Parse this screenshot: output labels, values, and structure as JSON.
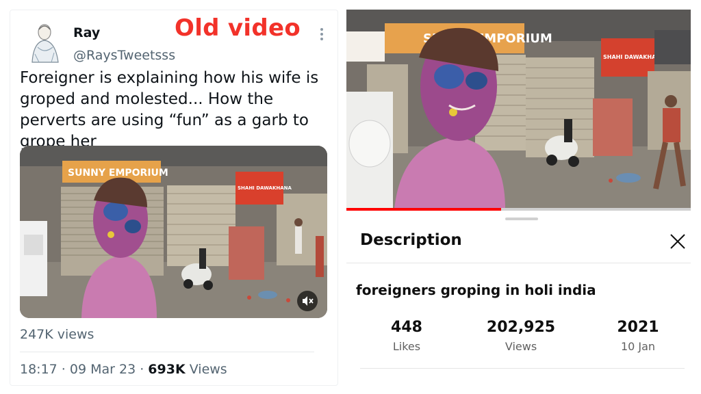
{
  "tweet": {
    "author_name": "Ray",
    "handle": "@RaysTweetsss",
    "overlay_caption": "Old video",
    "text": "Foreigner is explaining how his wife is groped and molested... How the perverts are using “fun” as a garb to grope her",
    "video_views": "247K views",
    "timestamp": "18:17 · 09 Mar 23 · ",
    "view_count": "693K",
    "view_label": " Views",
    "media_signs": {
      "shop_sign_1": "SUNNY EMPORIUM",
      "shop_sign_2": "SHAHI DAWAKHANA"
    },
    "icons": [
      "avatar",
      "more-vertical-icon",
      "mute-icon"
    ]
  },
  "youtube": {
    "sheet_title": "Description",
    "video_title": "foreigners groping in holi india",
    "progress": 0.45,
    "stats": [
      {
        "value": "448",
        "label": "Likes"
      },
      {
        "value": "202,925",
        "label": "Views"
      },
      {
        "value": "2021",
        "label": "10 Jan"
      }
    ],
    "media_signs": {
      "shop_sign_1": "SUNNY EMPORIUM",
      "shop_sign_2": "SHAHI DAWAKHANA"
    },
    "icons": [
      "close-icon"
    ]
  },
  "colors": {
    "overlay_red": "#f2322a",
    "secondary_text": "#536471",
    "youtube_red": "#ff0000"
  }
}
